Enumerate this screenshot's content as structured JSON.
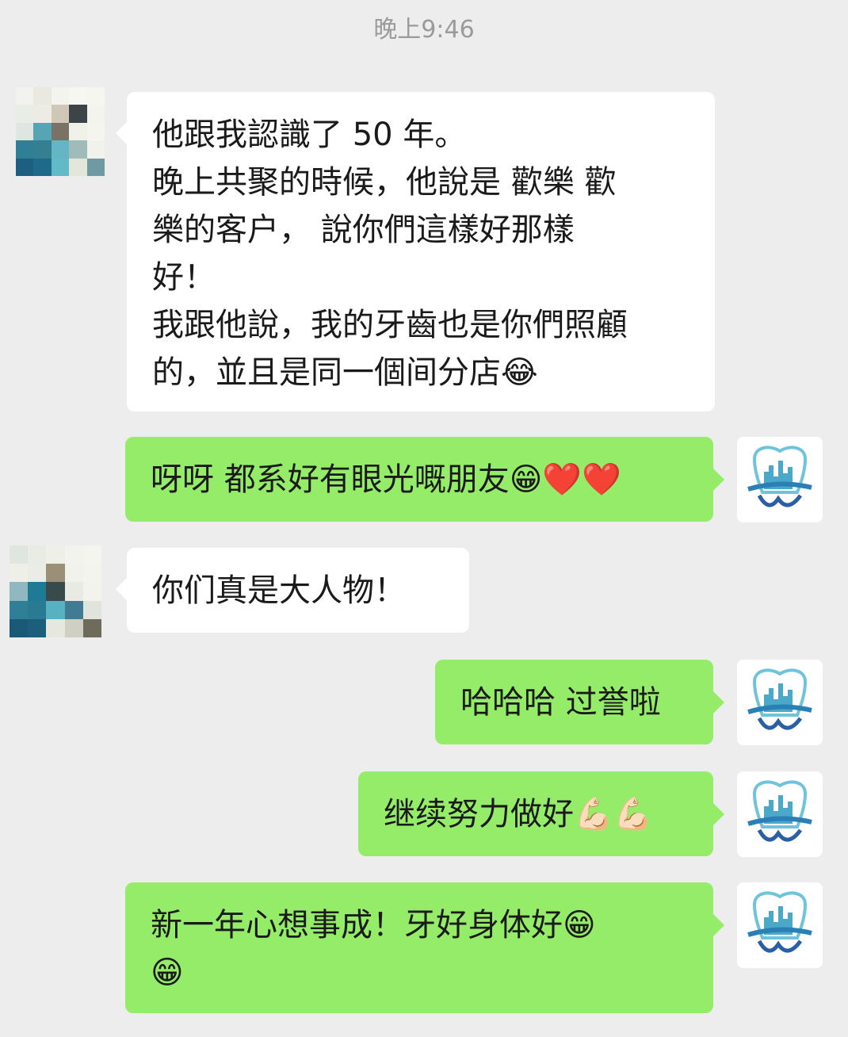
{
  "timestamp": "晚上9:46",
  "messages": [
    {
      "side": "in",
      "lines": [
        "他跟我認識了 50 年。",
        "晚上共聚的時候，他說是 歡樂 歡",
        "樂的客户， 說你們這樣好那樣",
        "好！",
        "我跟他說，我的牙齒也是你們照顧",
        "的，並且是同一個间分店😂"
      ]
    },
    {
      "side": "out",
      "text": "呀呀 都系好有眼光嘅朋友😁❤️❤️"
    },
    {
      "side": "in",
      "text": "你们真是大人物！"
    },
    {
      "side": "out",
      "text": "哈哈哈 过誉啦"
    },
    {
      "side": "out",
      "text": "继续努力做好💪🏻💪🏻"
    },
    {
      "side": "out",
      "lines": [
        "新一年心想事成！牙好身体好😁",
        "😁"
      ]
    }
  ],
  "colors": {
    "background": "#ededed",
    "incoming_bubble": "#ffffff",
    "outgoing_bubble": "#95ec69",
    "timestamp": "#9a9a9a"
  },
  "icons": {
    "sender_avatar": "pixelated-avatar-icon",
    "self_avatar": "tooth-logo-icon"
  }
}
